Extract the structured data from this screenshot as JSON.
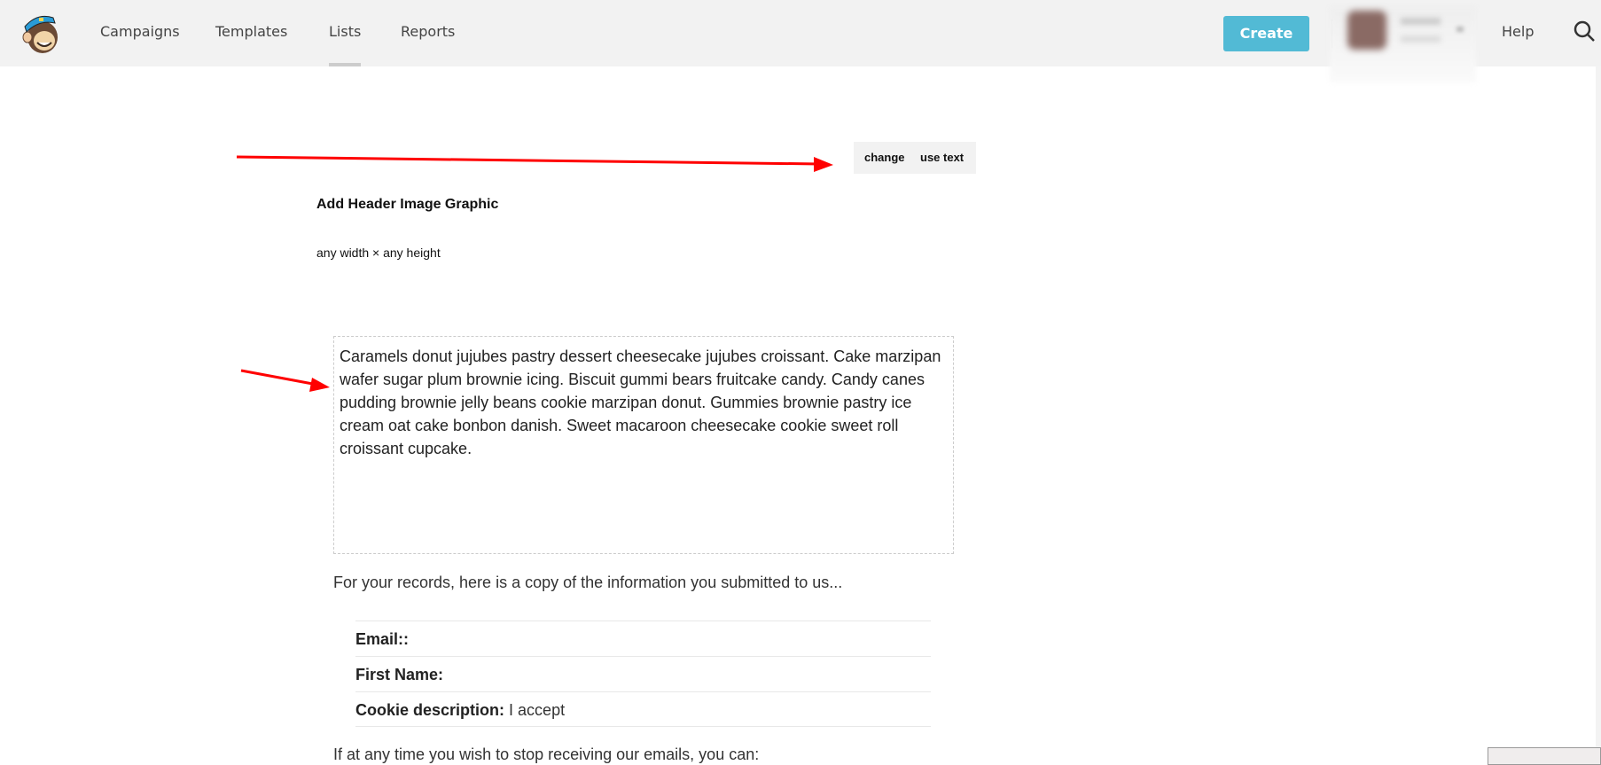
{
  "nav": {
    "items": [
      {
        "label": "Campaigns"
      },
      {
        "label": "Templates"
      },
      {
        "label": "Lists"
      },
      {
        "label": "Reports"
      }
    ],
    "active": "Lists",
    "create_label": "Create",
    "help_label": "Help",
    "accent": "#52bad5"
  },
  "editor": {
    "change_label": "change",
    "use_text_label": "use text",
    "header_title": "Add Header Image Graphic",
    "header_dims": "any width × any height",
    "body_text": "Caramels donut jujubes pastry dessert cheesecake jujubes croissant. Cake marzipan wafer sugar plum brownie icing. Biscuit gummi bears fruitcake candy. Candy canes pudding brownie jelly beans cookie marzipan donut. Gummies brownie pastry ice cream oat cake bonbon danish. Sweet macaroon cheesecake cookie sweet roll croissant cupcake.",
    "records_text": "For your records, here is a copy of the information you submitted to us...",
    "fields": [
      {
        "label": "Email::",
        "value": ""
      },
      {
        "label": "First Name:",
        "value": ""
      },
      {
        "label": "Cookie description:",
        "value": "I accept"
      }
    ],
    "stop_text": "If at any time you wish to stop receiving our emails, you can:"
  },
  "annotation_color": "#ff0000"
}
